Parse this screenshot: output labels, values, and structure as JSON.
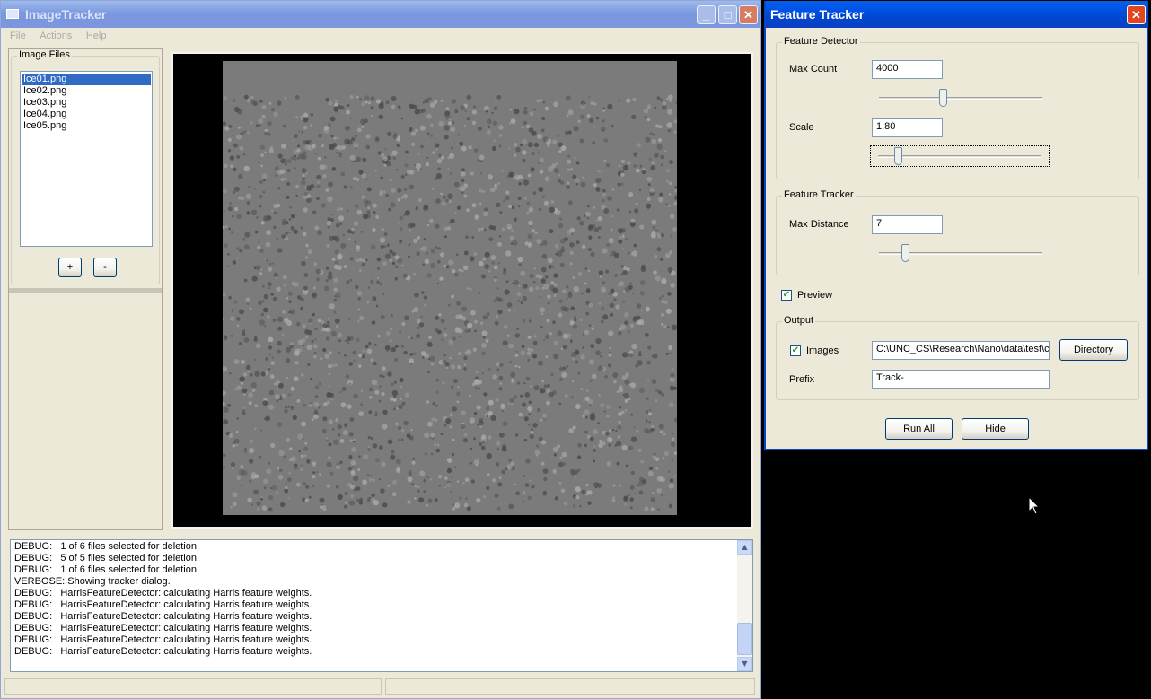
{
  "main_window": {
    "title": "ImageTracker",
    "menu": [
      "File",
      "Actions",
      "Help"
    ],
    "minimize_glyph": "_",
    "maximize_glyph": "□",
    "close_glyph": "✕",
    "image_files": {
      "group_title": "Image Files",
      "files": [
        "Ice01.png",
        "Ice02.png",
        "Ice03.png",
        "Ice04.png",
        "Ice05.png"
      ],
      "selected_index": 0,
      "add_label": "+",
      "remove_label": "-"
    },
    "log": [
      "DEBUG:   1 of 6 files selected for deletion.",
      "DEBUG:   5 of 5 files selected for deletion.",
      "DEBUG:   1 of 6 files selected for deletion.",
      "VERBOSE: Showing tracker dialog.",
      "DEBUG:   HarrisFeatureDetector: calculating Harris feature weights.",
      "DEBUG:   HarrisFeatureDetector: calculating Harris feature weights.",
      "DEBUG:   HarrisFeatureDetector: calculating Harris feature weights.",
      "DEBUG:   HarrisFeatureDetector: calculating Harris feature weights.",
      "DEBUG:   HarrisFeatureDetector: calculating Harris feature weights.",
      "DEBUG:   HarrisFeatureDetector: calculating Harris feature weights."
    ]
  },
  "tracker_dialog": {
    "title": "Feature Tracker",
    "close_glyph": "✕",
    "feature_detector": {
      "group_title": "Feature Detector",
      "max_count_label": "Max Count",
      "max_count_value": "4000",
      "max_count_slider_fraction": 0.39,
      "scale_label": "Scale",
      "scale_value": "1.80",
      "scale_slider_fraction": 0.12
    },
    "feature_tracker": {
      "group_title": "Feature Tracker",
      "max_distance_label": "Max Distance",
      "max_distance_value": "7",
      "max_distance_slider_fraction": 0.16
    },
    "preview_label": "Preview",
    "preview_checked": true,
    "output": {
      "group_title": "Output",
      "images_label": "Images",
      "images_checked": true,
      "images_path": "C:\\UNC_CS\\Research\\Nano\\data\\test\\c",
      "directory_label": "Directory",
      "prefix_label": "Prefix",
      "prefix_value": "Track-"
    },
    "run_all_label": "Run All",
    "hide_label": "Hide"
  },
  "colors": {
    "title_active": "#0054e3",
    "selection": "#316ac5",
    "image_gray": "#7b7b7b"
  }
}
